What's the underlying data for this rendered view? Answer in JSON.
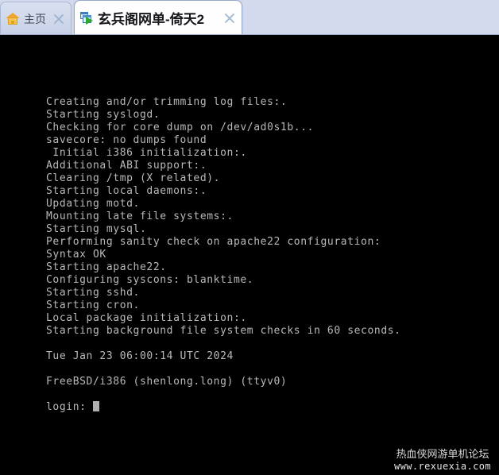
{
  "browser": {
    "tabs": [
      {
        "id": "home",
        "label": "主页",
        "icon": "home-icon",
        "close_icon": "close-icon",
        "active": false
      },
      {
        "id": "game-portal",
        "label": "玄兵阁网单-倚天2",
        "icon": "app-window-play-icon",
        "close_icon": "close-icon",
        "active": true
      }
    ]
  },
  "terminal": {
    "background_color": "#000000",
    "text_color": "#b9b9b9",
    "lines": [
      "Creating and/or trimming log files:.",
      "Starting syslogd.",
      "Checking for core dump on /dev/ad0s1b...",
      "savecore: no dumps found",
      " Initial i386 initialization:.",
      "Additional ABI support:.",
      "Clearing /tmp (X related).",
      "Starting local daemons:.",
      "Updating motd.",
      "Mounting late file systems:.",
      "Starting mysql.",
      "Performing sanity check on apache22 configuration:",
      "Syntax OK",
      "Starting apache22.",
      "Configuring syscons: blanktime.",
      "Starting sshd.",
      "Starting cron.",
      "Local package initialization:.",
      "Starting background file system checks in 60 seconds.",
      "",
      "Tue Jan 23 06:00:14 UTC 2024",
      "",
      "FreeBSD/i386 (shenlong.long) (ttyv0)",
      "",
      "login: "
    ],
    "prompt": "login: ",
    "cursor": "block-cursor"
  },
  "watermark": {
    "line1": "热血侠网游单机论坛",
    "line2": "www.rexuexia.com"
  }
}
